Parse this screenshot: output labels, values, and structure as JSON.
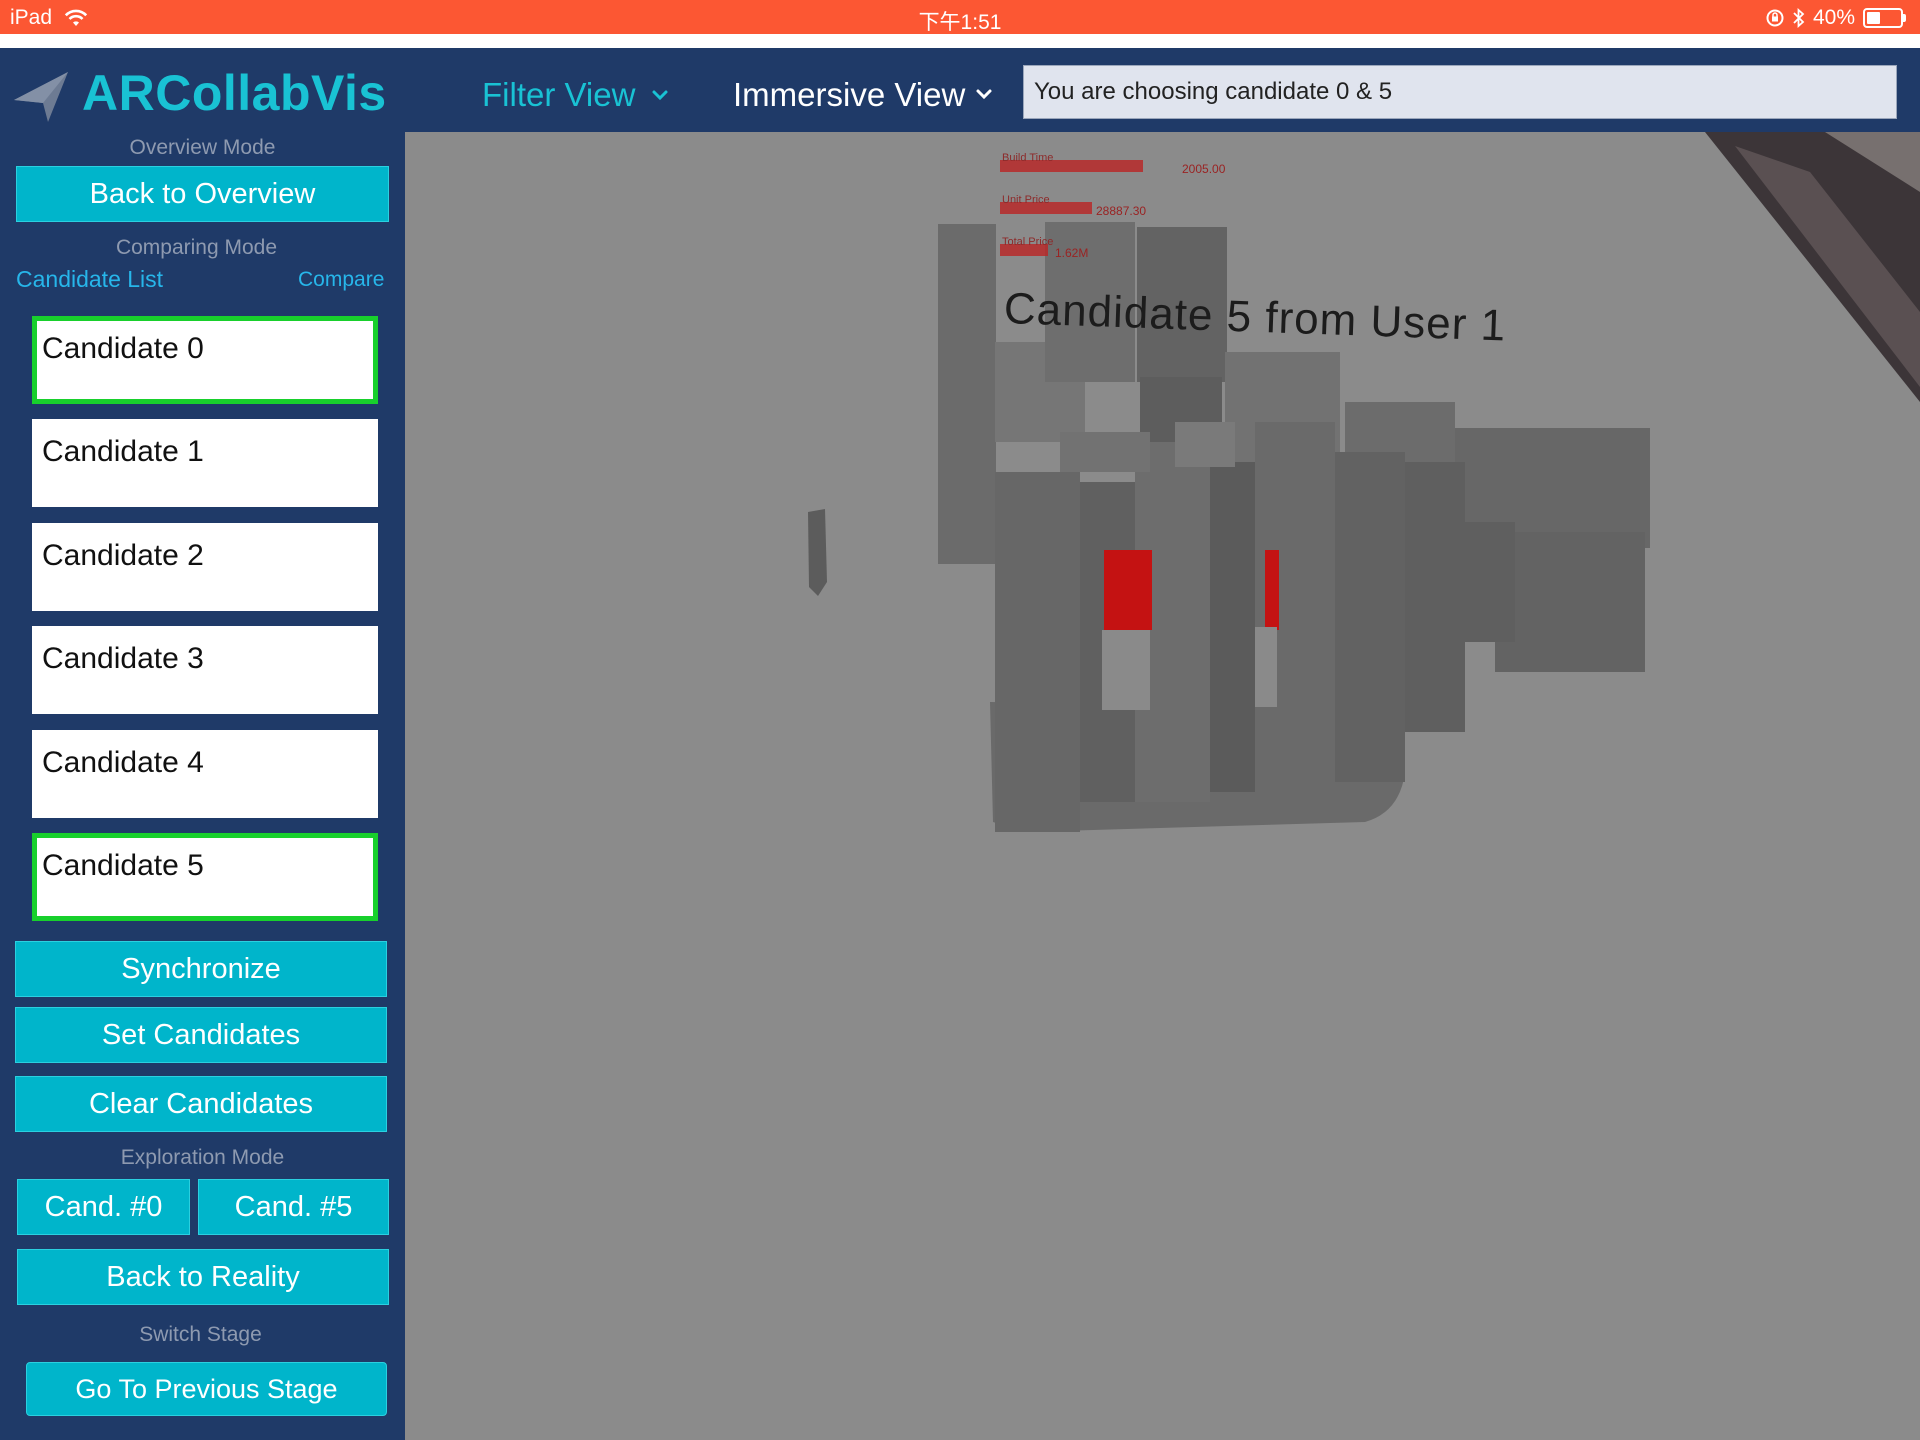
{
  "status_bar": {
    "device": "iPad",
    "time": "下午1:51",
    "battery": "40%",
    "battery_level": 0.4
  },
  "header": {
    "app_title": "ARCollabVis",
    "tabs": [
      {
        "label": "Filter View",
        "active": true
      },
      {
        "label": "Immersive View",
        "active": false
      }
    ],
    "status_message": "You are choosing candidate 0 & 5"
  },
  "sidebar": {
    "overview_mode_label": "Overview Mode",
    "back_to_overview": "Back to Overview",
    "comparing_mode_label": "Comparing Mode",
    "candidate_list_link": "Candidate List",
    "compare_link": "Compare",
    "candidates": [
      {
        "label": "Candidate 0",
        "selected": true
      },
      {
        "label": "Candidate 1",
        "selected": false
      },
      {
        "label": "Candidate 2",
        "selected": false
      },
      {
        "label": "Candidate 3",
        "selected": false
      },
      {
        "label": "Candidate 4",
        "selected": false
      },
      {
        "label": "Candidate 5",
        "selected": true
      }
    ],
    "synchronize": "Synchronize",
    "set_candidates": "Set Candidates",
    "clear_candidates": "Clear Candidates",
    "exploration_mode_label": "Exploration Mode",
    "cand_0": "Cand. #0",
    "cand_5": "Cand. #5",
    "back_to_reality": "Back to Reality",
    "switch_stage_label": "Switch Stage",
    "previous_stage": "Go To Previous Stage"
  },
  "scene": {
    "candidate_caption": "Candidate 5 from User 1",
    "bars": [
      {
        "label": "Build Time",
        "value": "2005.00"
      },
      {
        "label": "Unit Price",
        "value": "28887.30"
      },
      {
        "label": "Total Price",
        "value": "1.62M"
      }
    ]
  },
  "colors": {
    "status_bar": "#fc5733",
    "navy": "#1f3a68",
    "teal": "#00b5cb",
    "accent_text": "#19c2d4",
    "selection_green": "#18d02c",
    "highlight_red": "#cc1111"
  }
}
